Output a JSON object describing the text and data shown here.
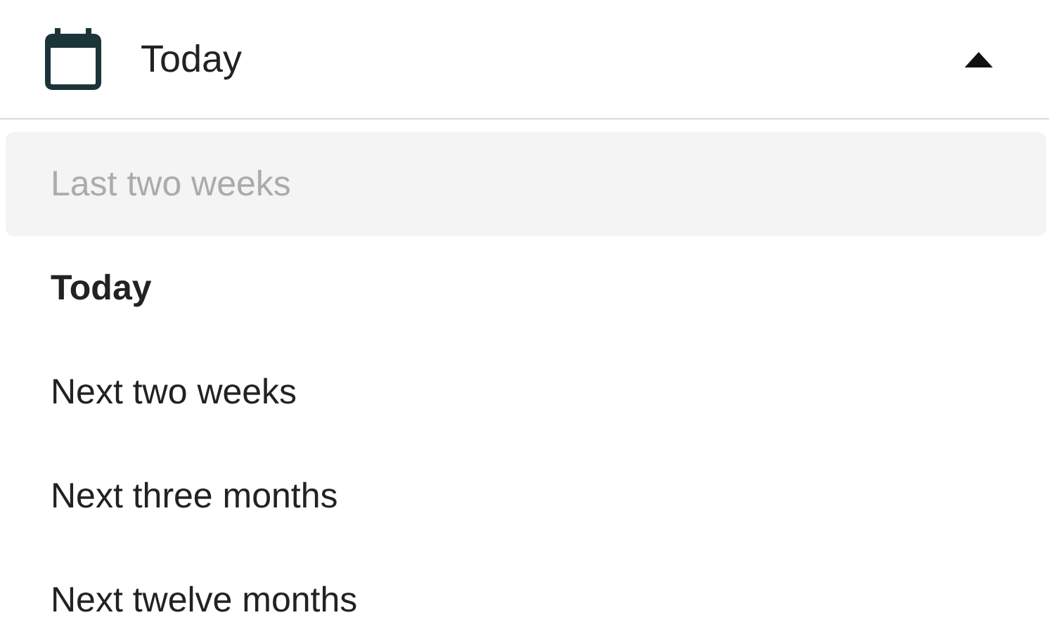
{
  "dropdown": {
    "value": "Today",
    "expanded": true,
    "options": [
      {
        "label": "Last two weeks",
        "selected": false,
        "disabled": true
      },
      {
        "label": "Today",
        "selected": true,
        "disabled": false
      },
      {
        "label": "Next two weeks",
        "selected": false,
        "disabled": false
      },
      {
        "label": "Next three months",
        "selected": false,
        "disabled": false
      },
      {
        "label": "Next twelve months",
        "selected": false,
        "disabled": false
      }
    ]
  }
}
